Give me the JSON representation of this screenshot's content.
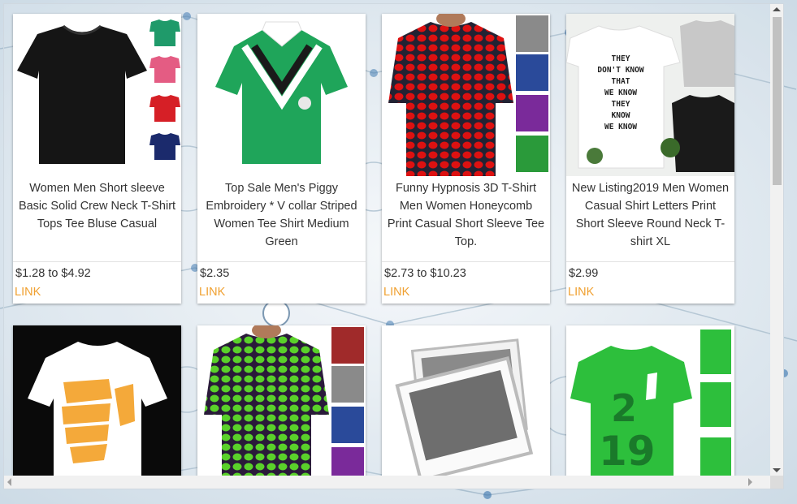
{
  "products": [
    {
      "title": "Women Men Short sleeve Basic Solid Crew Neck T-Shirt Tops Tee Bluse Casual",
      "price": "$1.28 to $4.92",
      "link": "LINK"
    },
    {
      "title": "Top Sale Men's Piggy Embroidery * V collar Striped Women Tee Shirt Medium Green",
      "price": "$2.35",
      "link": "LINK"
    },
    {
      "title": "Funny Hypnosis 3D T-Shirt Men Women Honeycomb Print Casual Short Sleeve Tee Top.",
      "price": "$2.73 to $10.23",
      "link": "LINK"
    },
    {
      "title": "New Listing2019 Men Women Casual Shirt Letters Print Short Sleeve Round Neck T-shirt XL",
      "price": "$2.99",
      "link": "LINK"
    }
  ],
  "shirt_text": {
    "line1": "THEY",
    "line2": "DON'T KNOW",
    "line3": "THAT",
    "line4": "WE KNOW",
    "line5": "THEY",
    "line6": "KNOW",
    "line7": "WE KNOW"
  },
  "jersey_number": {
    "top": "2",
    "bottom": "19"
  },
  "colors": {
    "link": "#f0a030",
    "card_bg": "#ffffff",
    "text": "#333333"
  },
  "scroll": {
    "vertical_position": 0
  }
}
